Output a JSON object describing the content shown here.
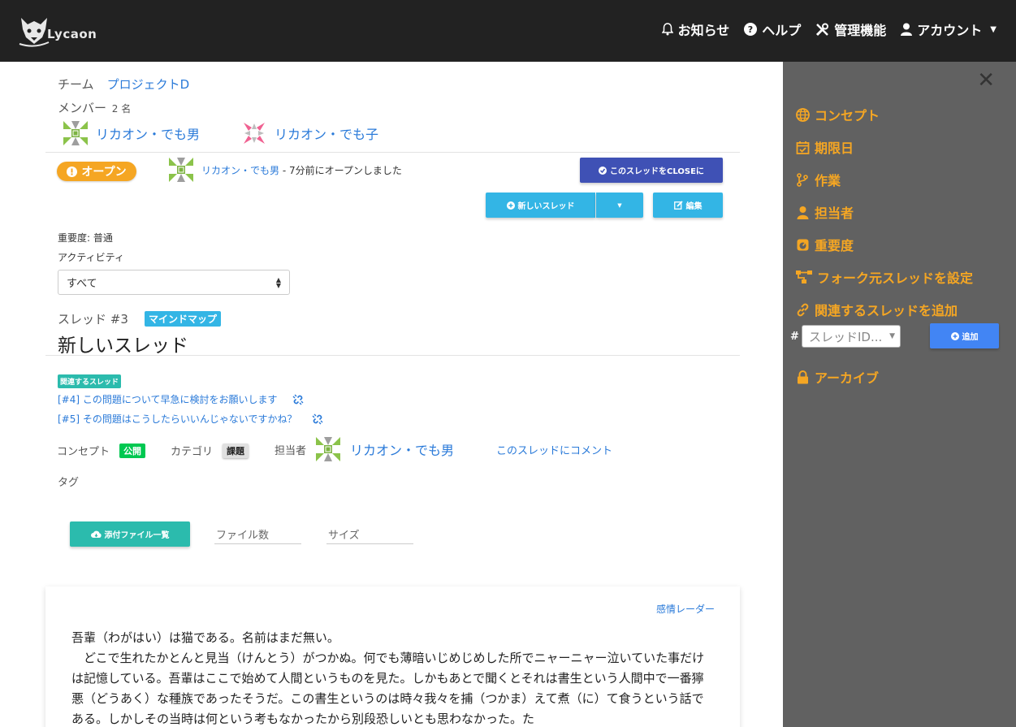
{
  "header": {
    "logo_text": "Lycaon",
    "nav": {
      "notifications": "お知らせ",
      "help": "ヘルプ",
      "admin": "管理機能",
      "account": "アカウント"
    }
  },
  "team": {
    "label": "チーム",
    "name": "プロジェクトD"
  },
  "members": {
    "label": "メンバー",
    "count": "2 名",
    "list": [
      {
        "name": "リカオン・でも男"
      },
      {
        "name": "リカオン・でも子"
      }
    ]
  },
  "status": {
    "badge": "オープン",
    "user": "リカオン・でも男",
    "message": " - 7分前にオープンしました"
  },
  "buttons": {
    "close_thread": "このスレッドをCLOSEに",
    "new_thread": "新しいスレッド",
    "edit": "編集",
    "attachments": "添付ファイル一覧",
    "add": "追加"
  },
  "importance": "重要度: 普通",
  "activity": {
    "label": "アクティビティ",
    "selected": "すべて"
  },
  "thread": {
    "number": "スレッド #3",
    "type_badge": "マインドマップ",
    "title": "新しいスレッド"
  },
  "related": {
    "badge": "関連するスレッド",
    "links": [
      "[#4] この問題について早急に検討をお願いします",
      "[#5] その問題はこうしたらいいんじゃないですかね？"
    ]
  },
  "meta": {
    "concept_label": "コンセプト",
    "concept_value": "公開",
    "category_label": "カテゴリ",
    "category_value": "課題",
    "assignee_label": "担当者",
    "assignee_name": "リカオン・でも男",
    "comment_link": "このスレッドにコメント",
    "tag_label": "タグ"
  },
  "files": {
    "count_placeholder": "ファイル数",
    "size_placeholder": "サイズ"
  },
  "card": {
    "emotion_link": "感情レーダー",
    "paragraphs": [
      "吾輩（わがはい）は猫である。名前はまだ無い。",
      "　どこで生れたかとんと見当（けんとう）がつかぬ。何でも薄暗いじめじめした所でニャーニャー泣いていた事だけは記憶している。吾輩はここで始めて人間というものを見た。しかもあとで聞くとそれは書生という人間中で一番獰悪（どうあく）な種族であったそうだ。この書生というのは時々我々を捕（つかま）えて煮（に）て食うという話である。しかしその当時は何という考もなかったから別段恐しいとも思わなかった。た"
    ]
  },
  "right_panel": {
    "items": [
      "コンセプト",
      "期限日",
      "作業",
      "担当者",
      "重要度",
      "フォーク元スレッドを設定",
      "関連するスレッドを追加",
      "アーカイブ"
    ],
    "hash": "#",
    "thread_id_placeholder": "スレッドID..."
  },
  "colors": {
    "header_bg": "#222222",
    "panel_bg": "#616161",
    "panel_accent": "#f5a623",
    "link": "#2a7ad9",
    "open_badge": "#f5a623",
    "close_button": "#3f51b5",
    "info_button": "#33b5e5",
    "teal": "#2bbbad"
  }
}
